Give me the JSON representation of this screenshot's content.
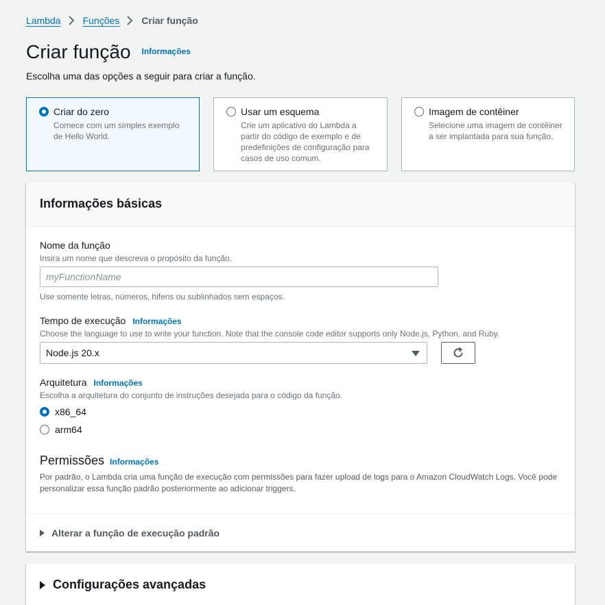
{
  "breadcrumb": {
    "items": [
      "Lambda",
      "Funções"
    ],
    "current": "Criar função"
  },
  "header": {
    "title": "Criar função",
    "info": "Informações",
    "description": "Escolha uma das opções a seguir para criar a função."
  },
  "creation_options": [
    {
      "title": "Criar do zero",
      "desc_lines": [
        "Comece com um simples exemplo",
        "de Hello World."
      ],
      "selected": true
    },
    {
      "title": "Usar um esquema",
      "desc_lines": [
        "Crie um aplicativo do Lambda a",
        "partir do código de exemplo e de",
        "predefinições de configuração para",
        "casos de uso comum."
      ],
      "selected": false
    },
    {
      "title": "Imagem de contêiner",
      "desc_lines": [
        "Selecione uma imagem de contêiner",
        "a ser implantada para sua função."
      ],
      "selected": false
    }
  ],
  "basic_info": {
    "title": "Informações básicas",
    "function_name": {
      "label": "Nome da função",
      "description": "Insira um nome que descreva o propósito da função.",
      "placeholder": "myFunctionName",
      "value": "",
      "constraint": "Use somente letras, números, hifens ou sublinhados sem espaços."
    },
    "runtime": {
      "label": "Tempo de execução",
      "info": "Informações",
      "description": "Choose the language to use to write your function. Note that the console code editor supports only Node.js, Python, and Ruby.",
      "selected": "Node.js 20.x",
      "refresh_icon": "refresh-icon"
    },
    "architecture": {
      "label": "Arquitetura",
      "info": "Informações",
      "description": "Escolha a arquitetura do conjunto de instruções desejada para o código da função.",
      "options": [
        {
          "label": "x86_64",
          "selected": true
        },
        {
          "label": "arm64",
          "selected": false
        }
      ]
    },
    "permissions": {
      "title": "Permissões",
      "info": "Informações",
      "description_lines": [
        "Por padrão, o Lambda cria uma função de execução com permissões para fazer upload de logs para o Amazon CloudWatch Logs. Você pode",
        "personalizar essa função padrão posteriormente ao adicionar triggers."
      ]
    },
    "expand_label": "Alterar a função de execução padrão"
  },
  "advanced": {
    "title": "Configurações avançadas"
  },
  "colors": {
    "accent": "#0073bb",
    "selected_bg": "#f1faff",
    "page_bg": "#f2f3f3"
  }
}
